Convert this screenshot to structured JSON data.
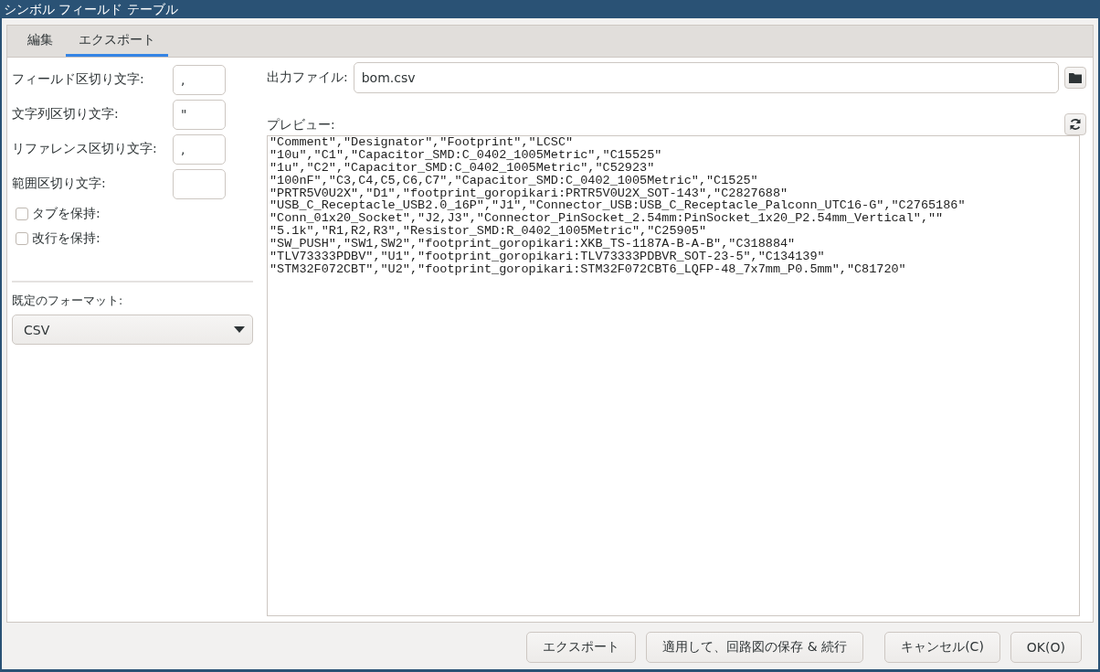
{
  "window": {
    "title": "シンボル フィールド テーブル"
  },
  "tabs": [
    {
      "label": "編集",
      "selected": false
    },
    {
      "label": "エクスポート",
      "selected": true
    }
  ],
  "delimiters": [
    {
      "label": "フィールド区切り文字:",
      "value": ","
    },
    {
      "label": "文字列区切り文字:",
      "value": "\""
    },
    {
      "label": "リファレンス区切り文字:",
      "value": ","
    },
    {
      "label": "範囲区切り文字:"
    }
  ],
  "options": [
    {
      "label": "タブを保持:",
      "checked": false
    },
    {
      "label": "改行を保持:",
      "checked": false
    }
  ],
  "format": {
    "label": "既定のフォーマット:",
    "value": "CSV"
  },
  "output": {
    "label": "出力ファイル:",
    "value": "bom.csv"
  },
  "preview": {
    "label": "プレビュー:",
    "lines": [
      "\"Comment\",\"Designator\",\"Footprint\",\"LCSC\"",
      "\"10u\",\"C1\",\"Capacitor_SMD:C_0402_1005Metric\",\"C15525\"",
      "\"1u\",\"C2\",\"Capacitor_SMD:C_0402_1005Metric\",\"C52923\"",
      "\"100nF\",\"C3,C4,C5,C6,C7\",\"Capacitor_SMD:C_0402_1005Metric\",\"C1525\"",
      "\"PRTR5V0U2X\",\"D1\",\"footprint_goropikari:PRTR5V0U2X_SOT-143\",\"C2827688\"",
      "\"USB_C_Receptacle_USB2.0_16P\",\"J1\",\"Connector_USB:USB_C_Receptacle_Palconn_UTC16-G\",\"C2765186\"",
      "\"Conn_01x20_Socket\",\"J2,J3\",\"Connector_PinSocket_2.54mm:PinSocket_1x20_P2.54mm_Vertical\",\"\"",
      "\"5.1k\",\"R1,R2,R3\",\"Resistor_SMD:R_0402_1005Metric\",\"C25905\"",
      "\"SW_PUSH\",\"SW1,SW2\",\"footprint_goropikari:XKB_TS-1187A-B-A-B\",\"C318884\"",
      "\"TLV73333PDBV\",\"U1\",\"footprint_goropikari:TLV73333PDBVR_SOT-23-5\",\"C134139\"",
      "\"STM32F072CBT\",\"U2\",\"footprint_goropikari:STM32F072CBT6_LQFP-48_7x7mm_P0.5mm\",\"C81720\""
    ]
  },
  "buttons": [
    "エクスポート",
    "適用して、回路図の保存 & 続行",
    "キャンセル(C)",
    "OK(O)"
  ]
}
